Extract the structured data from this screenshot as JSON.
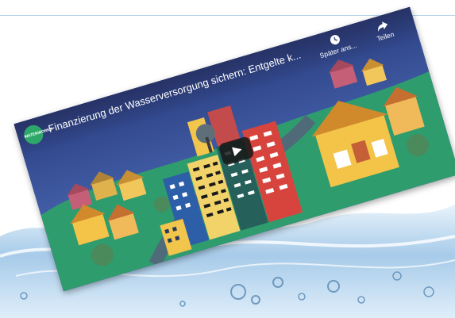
{
  "video": {
    "channel_avatar_label": "WATERWORKS",
    "title": "Finanzierung der Wasserversorgung sichern: Entgelte k...",
    "watch_later_label": "Später ans...",
    "share_label": "Teilen",
    "play_icon": "play-icon",
    "watch_later_icon": "clock-icon",
    "share_icon": "share-arrow-icon"
  },
  "colors": {
    "sky": "#314a8a",
    "grass": "#2f9c6e",
    "tower_red": "#d7443e",
    "tower_yellow": "#f2d36a",
    "house_yellow": "#f4c449",
    "water": "#9fc6e8"
  }
}
